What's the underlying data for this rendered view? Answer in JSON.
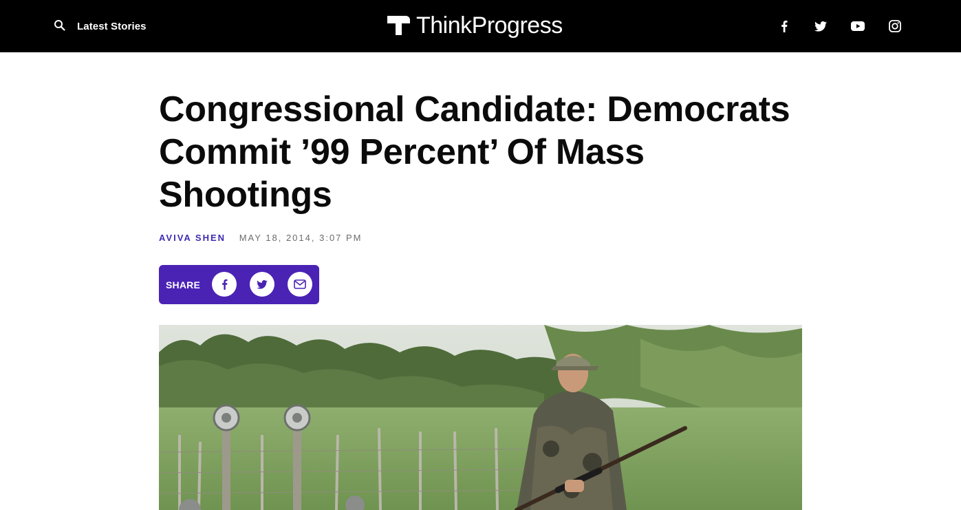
{
  "nav": {
    "search_icon": "search-icon",
    "latest_label": "Latest Stories",
    "logo_text": "ThinkProgress",
    "social_icons": [
      "facebook-icon",
      "twitter-icon",
      "youtube-icon",
      "instagram-icon"
    ]
  },
  "article": {
    "headline": "Congressional Candidate: Democrats Commit ’99 Percent’ Of Mass Shootings",
    "author": "AVIVA SHEN",
    "date": "MAY 18, 2014, 3:07 PM"
  },
  "share": {
    "label": "SHARE",
    "buttons": [
      "facebook-icon",
      "twitter-icon",
      "email-icon"
    ]
  },
  "colors": {
    "nav_bg": "#000000",
    "accent": "#4a23b5",
    "author": "#3d2bb3",
    "date": "#6b6b6b"
  }
}
